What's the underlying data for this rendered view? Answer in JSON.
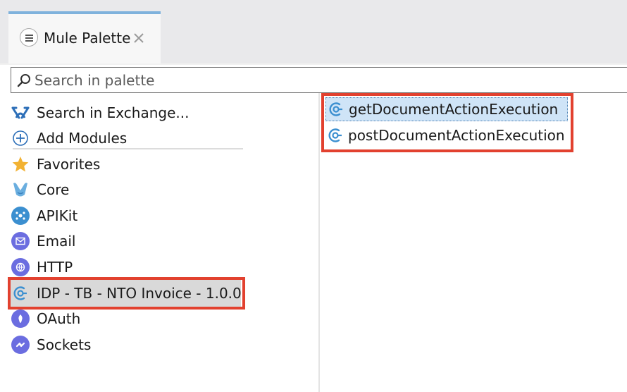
{
  "tab": {
    "title": "Mule Palette"
  },
  "search": {
    "placeholder": "Search in palette",
    "value": ""
  },
  "actions": [
    {
      "label": "Search in Exchange..."
    },
    {
      "label": "Add Modules"
    }
  ],
  "modules": [
    {
      "label": "Favorites"
    },
    {
      "label": "Core"
    },
    {
      "label": "APIKit"
    },
    {
      "label": "Email"
    },
    {
      "label": "HTTP"
    },
    {
      "label": "IDP - TB - NTO Invoice - 1.0.0",
      "selected": true
    },
    {
      "label": "OAuth"
    },
    {
      "label": "Sockets"
    }
  ],
  "operations": [
    {
      "label": "getDocumentActionExecution",
      "selected": true
    },
    {
      "label": "postDocumentActionExecution"
    }
  ],
  "colors": {
    "accent_tab": "#7fb2dc",
    "highlight": "#e2412f",
    "module_icon": "#6b6de0",
    "selection_bg": "#cfe4f7"
  }
}
